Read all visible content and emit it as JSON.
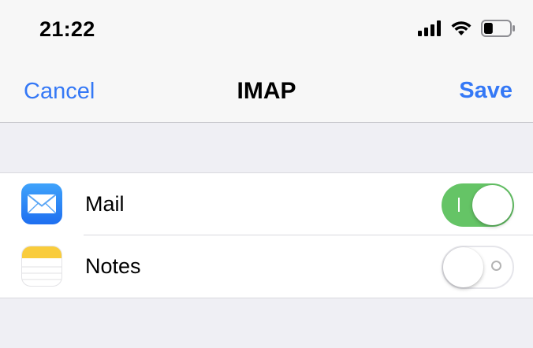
{
  "status_bar": {
    "time": "21:22",
    "icons": [
      "cellular-signal-icon",
      "wifi-icon",
      "battery-icon"
    ],
    "battery_level": 0.35
  },
  "nav": {
    "cancel_label": "Cancel",
    "title": "IMAP",
    "save_label": "Save",
    "accent_color": "#3478f6"
  },
  "list": {
    "items": [
      {
        "label": "Mail",
        "icon": "mail-icon",
        "enabled": true
      },
      {
        "label": "Notes",
        "icon": "notes-icon",
        "enabled": false
      }
    ]
  },
  "colors": {
    "toggle_on": "#65c466",
    "background": "#efeff4"
  }
}
